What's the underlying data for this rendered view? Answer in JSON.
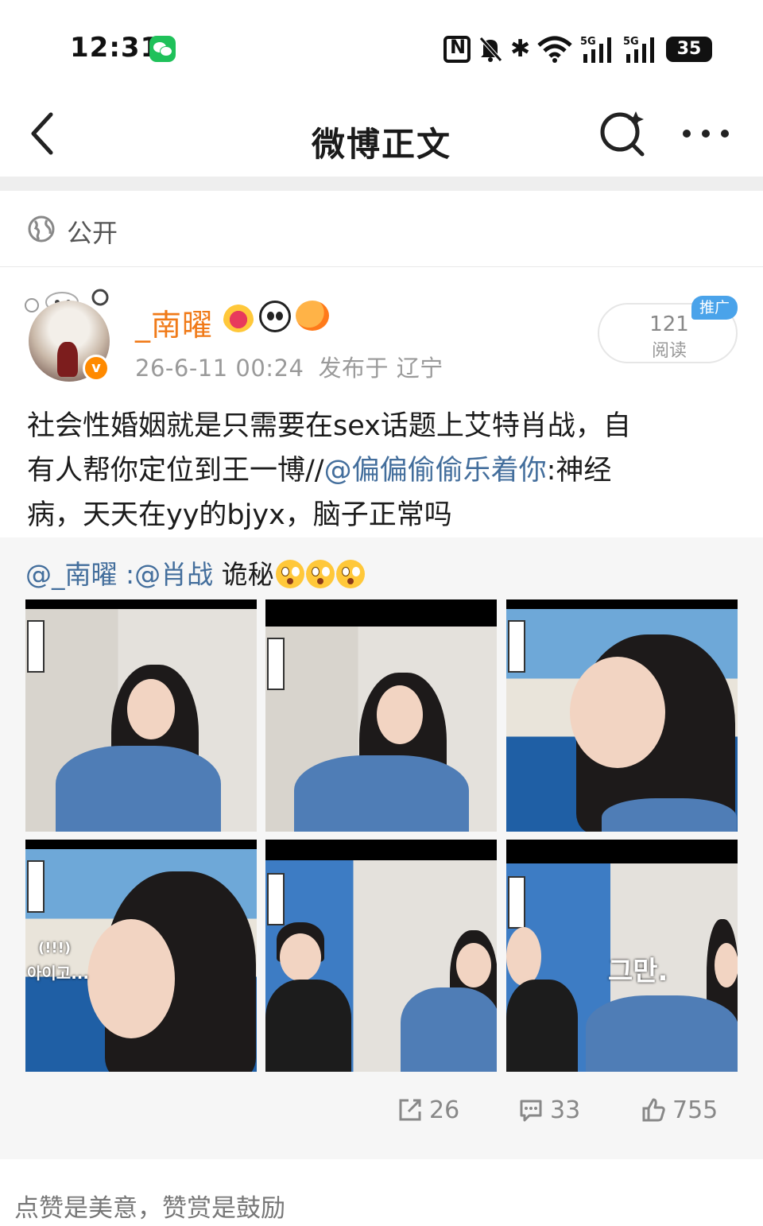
{
  "status_bar": {
    "time": "12:31",
    "battery": "35",
    "icons": [
      "wechat-icon",
      "nfc-icon",
      "mute-icon",
      "bluetooth-icon",
      "wifi-icon",
      "5g-signal-icon",
      "5g-signal-icon",
      "battery-icon"
    ]
  },
  "nav": {
    "title": "微博正文",
    "icons": [
      "back-icon",
      "search-icon",
      "more-icon"
    ]
  },
  "visibility": {
    "label": "公开",
    "icon": "globe-icon"
  },
  "author": {
    "name": "_南曜",
    "date": "26-6-11 00:24",
    "location": "发布于 辽宁",
    "badges": [
      "crown-badge",
      "panda-badge",
      "pufferfish-badge"
    ],
    "verified_color": "#ff8a00",
    "name_color": "#f07a18"
  },
  "reads": {
    "count": "121",
    "label": "阅读",
    "promo": "推广"
  },
  "post": {
    "line1": "社会性婚姻就是只需要在sex话题上艾特肖战，自",
    "line2_a": "有人帮你定位到王一博//",
    "line2_mention": "@偏偏偷偷乐着你",
    "line2_b": ":神经",
    "line3": "病，天天在yy的bjyx，脑子正常吗",
    "mention_color": "#436e9c"
  },
  "retweet": {
    "author": "@_南曜",
    "sep": " :",
    "mention": "@肖战",
    "text": " 诡秘",
    "images": [
      {
        "label": "photo-1"
      },
      {
        "label": "photo-2"
      },
      {
        "label": "photo-3"
      },
      {
        "label": "photo-4",
        "caption": "아이고..."
      },
      {
        "label": "photo-5"
      },
      {
        "label": "photo-6",
        "caption": "그만."
      }
    ],
    "photo_caption_4a": "(!!!)",
    "photo_caption_4b": "아이고...",
    "photo_caption_6": "그만."
  },
  "actions": {
    "repost": "26",
    "comment": "33",
    "like": "755"
  },
  "footer": {
    "text": "点赞是美意，赞赏是鼓励"
  }
}
